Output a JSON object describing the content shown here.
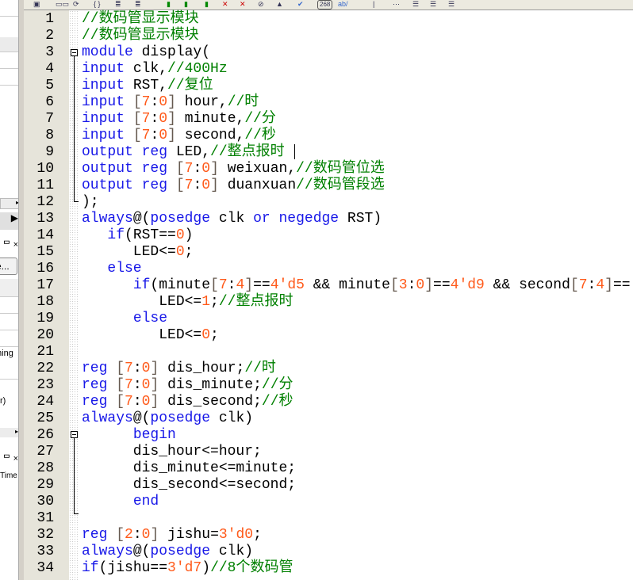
{
  "left_panel": {
    "button_label": "e...",
    "row_text_1": "ming",
    "row_text_2": "r)",
    "col_header": "Time",
    "pin_close": "ᄆ ×"
  },
  "toolbar": {
    "counter": "268",
    "ab_label": "ab/"
  },
  "editor": {
    "lines": [
      [
        [
          "//数码管显示模块",
          "c"
        ]
      ],
      [
        [
          "//数码管显示模块",
          "c"
        ]
      ],
      [
        [
          "module",
          "k"
        ],
        [
          " display(",
          ""
        ]
      ],
      [
        [
          "input",
          "k"
        ],
        [
          " clk,",
          ""
        ],
        [
          "//400Hz",
          "c"
        ]
      ],
      [
        [
          "input",
          "k"
        ],
        [
          " RST,",
          ""
        ],
        [
          "//复位",
          "c"
        ]
      ],
      [
        [
          "input",
          "k"
        ],
        [
          " ",
          ""
        ],
        [
          "[",
          "b"
        ],
        [
          "7",
          "n"
        ],
        [
          ":",
          ""
        ],
        [
          "0",
          "n"
        ],
        [
          "]",
          "b"
        ],
        [
          " hour,",
          ""
        ],
        [
          "//时",
          "c"
        ]
      ],
      [
        [
          "input",
          "k"
        ],
        [
          " ",
          ""
        ],
        [
          "[",
          "b"
        ],
        [
          "7",
          "n"
        ],
        [
          ":",
          ""
        ],
        [
          "0",
          "n"
        ],
        [
          "]",
          "b"
        ],
        [
          " minute,",
          ""
        ],
        [
          "//分",
          "c"
        ]
      ],
      [
        [
          "input",
          "k"
        ],
        [
          " ",
          ""
        ],
        [
          "[",
          "b"
        ],
        [
          "7",
          "n"
        ],
        [
          ":",
          ""
        ],
        [
          "0",
          "n"
        ],
        [
          "]",
          "b"
        ],
        [
          " second,",
          ""
        ],
        [
          "//秒",
          "c"
        ]
      ],
      [
        [
          "output",
          "k"
        ],
        [
          " ",
          ""
        ],
        [
          "reg",
          "k"
        ],
        [
          " LED,",
          ""
        ],
        [
          "//整点报时",
          "c"
        ]
      ],
      [
        [
          "output",
          "k"
        ],
        [
          " ",
          ""
        ],
        [
          "reg",
          "k"
        ],
        [
          " ",
          ""
        ],
        [
          "[",
          "b"
        ],
        [
          "7",
          "n"
        ],
        [
          ":",
          ""
        ],
        [
          "0",
          "n"
        ],
        [
          "]",
          "b"
        ],
        [
          " weixuan,",
          ""
        ],
        [
          "//数码管位选",
          "c"
        ]
      ],
      [
        [
          "output",
          "k"
        ],
        [
          " ",
          ""
        ],
        [
          "reg",
          "k"
        ],
        [
          " ",
          ""
        ],
        [
          "[",
          "b"
        ],
        [
          "7",
          "n"
        ],
        [
          ":",
          ""
        ],
        [
          "0",
          "n"
        ],
        [
          "]",
          "b"
        ],
        [
          " duanxuan",
          ""
        ],
        [
          "//数码管段选",
          "c"
        ]
      ],
      [
        [
          ");",
          ""
        ]
      ],
      [
        [
          "always",
          "k"
        ],
        [
          "@(",
          ""
        ],
        [
          "posedge",
          "k"
        ],
        [
          " clk ",
          ""
        ],
        [
          "or",
          "k"
        ],
        [
          " ",
          ""
        ],
        [
          "negedge",
          "k"
        ],
        [
          " RST)",
          ""
        ]
      ],
      [
        [
          "   ",
          ""
        ],
        [
          "if",
          "k"
        ],
        [
          "(RST==",
          ""
        ],
        [
          "0",
          "n"
        ],
        [
          ")",
          ""
        ]
      ],
      [
        [
          "      LED<=",
          ""
        ],
        [
          "0",
          "n"
        ],
        [
          ";",
          ""
        ]
      ],
      [
        [
          "   ",
          ""
        ],
        [
          "else",
          "k"
        ]
      ],
      [
        [
          "      ",
          ""
        ],
        [
          "if",
          "k"
        ],
        [
          "(minute",
          ""
        ],
        [
          "[",
          "b"
        ],
        [
          "7",
          "n"
        ],
        [
          ":",
          ""
        ],
        [
          "4",
          "n"
        ],
        [
          "]",
          "b"
        ],
        [
          "==",
          ""
        ],
        [
          "4'd5",
          "n"
        ],
        [
          " && minute",
          ""
        ],
        [
          "[",
          "b"
        ],
        [
          "3",
          "n"
        ],
        [
          ":",
          ""
        ],
        [
          "0",
          "n"
        ],
        [
          "]",
          "b"
        ],
        [
          "==",
          ""
        ],
        [
          "4'd9",
          "n"
        ],
        [
          " && second",
          ""
        ],
        [
          "[",
          "b"
        ],
        [
          "7",
          "n"
        ],
        [
          ":",
          ""
        ],
        [
          "4",
          "n"
        ],
        [
          "]",
          "b"
        ],
        [
          "==",
          ""
        ]
      ],
      [
        [
          "         LED<=",
          ""
        ],
        [
          "1",
          "n"
        ],
        [
          ";",
          ""
        ],
        [
          "//整点报时",
          "c"
        ]
      ],
      [
        [
          "      ",
          ""
        ],
        [
          "else",
          "k"
        ]
      ],
      [
        [
          "         LED<=",
          ""
        ],
        [
          "0",
          "n"
        ],
        [
          ";",
          ""
        ]
      ],
      [
        [
          "",
          ""
        ]
      ],
      [
        [
          "reg",
          "k"
        ],
        [
          " ",
          ""
        ],
        [
          "[",
          "b"
        ],
        [
          "7",
          "n"
        ],
        [
          ":",
          ""
        ],
        [
          "0",
          "n"
        ],
        [
          "]",
          "b"
        ],
        [
          " dis_hour;",
          ""
        ],
        [
          "//时",
          "c"
        ]
      ],
      [
        [
          "reg",
          "k"
        ],
        [
          " ",
          ""
        ],
        [
          "[",
          "b"
        ],
        [
          "7",
          "n"
        ],
        [
          ":",
          ""
        ],
        [
          "0",
          "n"
        ],
        [
          "]",
          "b"
        ],
        [
          " dis_minute;",
          ""
        ],
        [
          "//分",
          "c"
        ]
      ],
      [
        [
          "reg",
          "k"
        ],
        [
          " ",
          ""
        ],
        [
          "[",
          "b"
        ],
        [
          "7",
          "n"
        ],
        [
          ":",
          ""
        ],
        [
          "0",
          "n"
        ],
        [
          "]",
          "b"
        ],
        [
          " dis_second;",
          ""
        ],
        [
          "//秒",
          "c"
        ]
      ],
      [
        [
          "always",
          "k"
        ],
        [
          "@(",
          ""
        ],
        [
          "posedge",
          "k"
        ],
        [
          " clk)",
          ""
        ]
      ],
      [
        [
          "      ",
          ""
        ],
        [
          "begin",
          "k"
        ]
      ],
      [
        [
          "      dis_hour<=hour;",
          ""
        ]
      ],
      [
        [
          "      dis_minute<=minute;",
          ""
        ]
      ],
      [
        [
          "      dis_second<=second;",
          ""
        ]
      ],
      [
        [
          "      ",
          ""
        ],
        [
          "end",
          "k"
        ]
      ],
      [
        [
          "",
          ""
        ]
      ],
      [
        [
          "reg",
          "k"
        ],
        [
          " ",
          ""
        ],
        [
          "[",
          "b"
        ],
        [
          "2",
          "n"
        ],
        [
          ":",
          ""
        ],
        [
          "0",
          "n"
        ],
        [
          "]",
          "b"
        ],
        [
          " jishu=",
          ""
        ],
        [
          "3'd0",
          "n"
        ],
        [
          ";",
          ""
        ]
      ],
      [
        [
          "always",
          "k"
        ],
        [
          "@(",
          ""
        ],
        [
          "posedge",
          "k"
        ],
        [
          " clk)",
          ""
        ]
      ],
      [
        [
          "if",
          "k"
        ],
        [
          "(jishu==",
          ""
        ],
        [
          "3'd7",
          "n"
        ],
        [
          ")",
          ""
        ],
        [
          "//8个数码管",
          "c"
        ]
      ]
    ]
  }
}
